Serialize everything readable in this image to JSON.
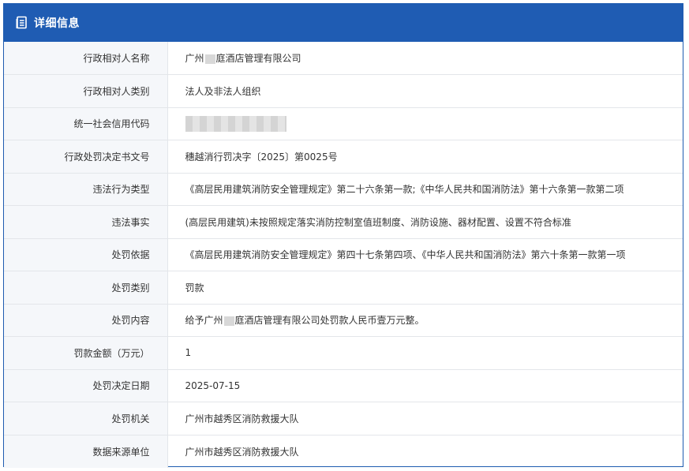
{
  "header": {
    "title": "详细信息",
    "icon": "document-list-icon"
  },
  "rows": [
    {
      "label": "行政相对人名称",
      "value_pre": "广州",
      "value_post": "庭酒店管理有限公司"
    },
    {
      "label": "行政相对人类别",
      "value": "法人及非法人组织"
    },
    {
      "label": "统一社会信用代码"
    },
    {
      "label": "行政处罚决定书文号",
      "value": "穗越消行罚决字〔2025〕第0025号"
    },
    {
      "label": "违法行为类型",
      "value": "《高层民用建筑消防安全管理规定》第二十六条第一款;《中华人民共和国消防法》第十六条第一款第二项"
    },
    {
      "label": "违法事实",
      "value": "(高层民用建筑)未按照规定落实消防控制室值班制度、消防设施、器材配置、设置不符合标准"
    },
    {
      "label": "处罚依据",
      "value": "《高层民用建筑消防安全管理规定》第四十七条第四项、《中华人民共和国消防法》第六十条第一款第一项"
    },
    {
      "label": "处罚类别",
      "value": "罚款"
    },
    {
      "label": "处罚内容",
      "value_pre": "给予广州",
      "value_post": "庭酒店管理有限公司处罚款人民币壹万元整。"
    },
    {
      "label": "罚款金额（万元）",
      "value": "1"
    },
    {
      "label": "处罚决定日期",
      "value": "2025-07-15"
    },
    {
      "label": "处罚机关",
      "value": "广州市越秀区消防救援大队"
    },
    {
      "label": "数据来源单位",
      "value": "广州市越秀区消防救援大队"
    }
  ]
}
